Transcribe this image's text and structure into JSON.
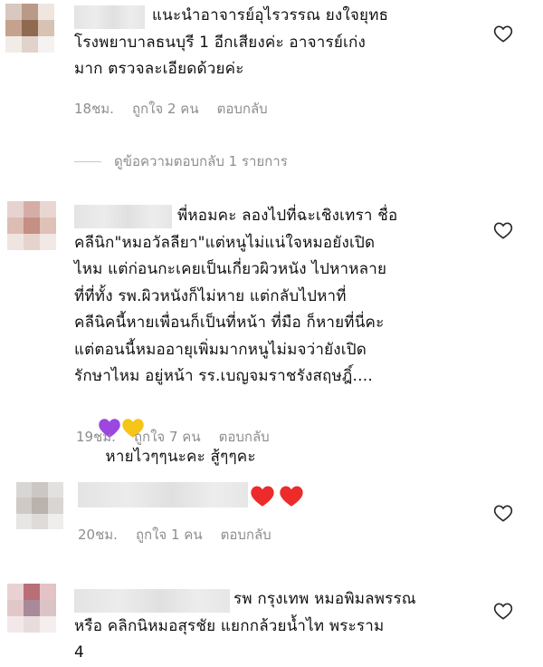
{
  "comments": [
    {
      "text": "แนะนำอาจารย์อุไรวรรณ ยงใจยุทธ\nโรงพยาบาลธนบุรี 1 อีกเสียงค่ะ อาจารย์เก่ง\nมาก ตรวจละเอียดด้วยค่ะ",
      "time": "18ชม.",
      "likes": "ถูกใจ 2 คน",
      "reply": "ตอบกลับ"
    },
    {
      "text": "พี่หอมคะ ลองไปที่ฉะเชิงเทรา ชื่อ\nคลีนิก\"หมอวัลลียา\"แต่หนูไม่แน่ใจหมอยังเปิด\nไหม แต่ก่อนกะเคยเป็นเกี่ยวผิวหนัง ไปหาหลาย\nที่ที่ทั้ง รพ.ผิวหนังก็ไม่หาย แต่กลับไปหาที่\nคลีนิคนี้หายเพื่อนก็เป็นที่หน้า ที่มือ ก็หายที่นี่คะ\nแต่ตอนนี้หมออายุเพิ่มมากหนูไม่มจว่ายังเปิด\nรักษาไหม อยู่หน้า รร.เบญจมราชรังสฤษฎิ์....",
      "text_tail": "หายไวๆๆนะคะ สู้ๆๆคะ",
      "time": "19ชม.",
      "likes": "ถูกใจ 7 คน",
      "reply": "ตอบกลับ"
    },
    {
      "text": "",
      "time": "20ชม.",
      "likes": "ถูกใจ 1 คน",
      "reply": "ตอบกลับ"
    },
    {
      "text": "รพ กรุงเทพ หมอพิมลพรรณ\nหรือ คลิกนิหมอสุรชัย แยกกล้วยน้ำไท พระราม\n4"
    }
  ],
  "view_replies": "ดูข้อความตอบกลับ 1 รายการ",
  "colors": {
    "muted": "#8e8e8e",
    "heart_red": "#ed2b2b",
    "purple_heart": "#9b47e0",
    "yellow_heart": "#f5c518"
  },
  "icons": {
    "like": "heart-outline-icon",
    "red_heart": "red-heart-emoji",
    "purple_heart": "purple-heart-emoji",
    "yellow_heart": "yellow-heart-emoji"
  }
}
